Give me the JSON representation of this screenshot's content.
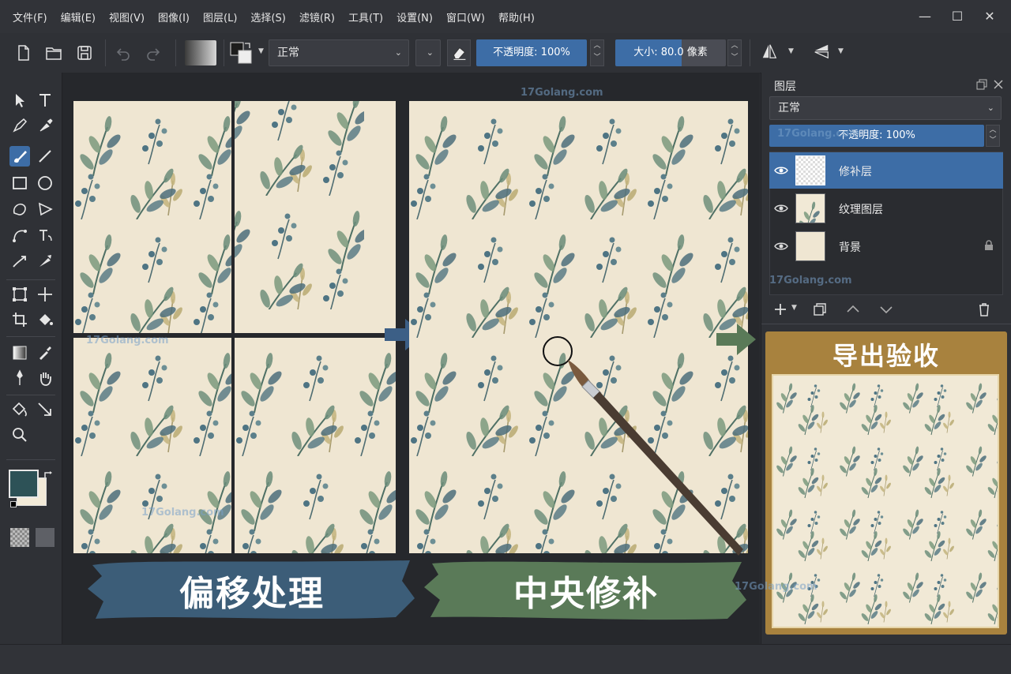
{
  "menubar": {
    "items": [
      "文件(F)",
      "编辑(E)",
      "视图(V)",
      "图像(I)",
      "图层(L)",
      "选择(S)",
      "滤镜(R)",
      "工具(T)",
      "设置(N)",
      "窗口(W)",
      "帮助(H)"
    ]
  },
  "window_controls": {
    "minimize": "—",
    "maximize": "☐",
    "close": "✕"
  },
  "toolbar": {
    "blend_mode": "正常",
    "opacity_label": "不透明度: 100%",
    "size_label": "大小: 80.0 像素"
  },
  "canvas": {
    "label_offset": "偏移处理",
    "label_patch": "中央修补",
    "label_export": "导出验收",
    "colors": {
      "offset_brush": "#3c5d78",
      "patch_brush": "#5a7a58",
      "export_frame": "#a8823e",
      "paper": "#efe6d2"
    }
  },
  "layers_panel": {
    "title": "图层",
    "blend_mode": "正常",
    "opacity_label": "不透明度: 100%",
    "layers": [
      {
        "name": "修补层",
        "selected": true,
        "locked": false
      },
      {
        "name": "纹理图层",
        "selected": false,
        "locked": false
      },
      {
        "name": "背景",
        "selected": false,
        "locked": true
      }
    ]
  },
  "colors": {
    "accent": "#3d6da6",
    "foreground": "#2d5257",
    "background": "#f2ead8"
  },
  "watermarks": [
    "17Golang.com",
    "17Golang.com",
    "17Golang.com",
    "17Golang.com",
    "17Golang.com",
    "17Golang.com"
  ]
}
